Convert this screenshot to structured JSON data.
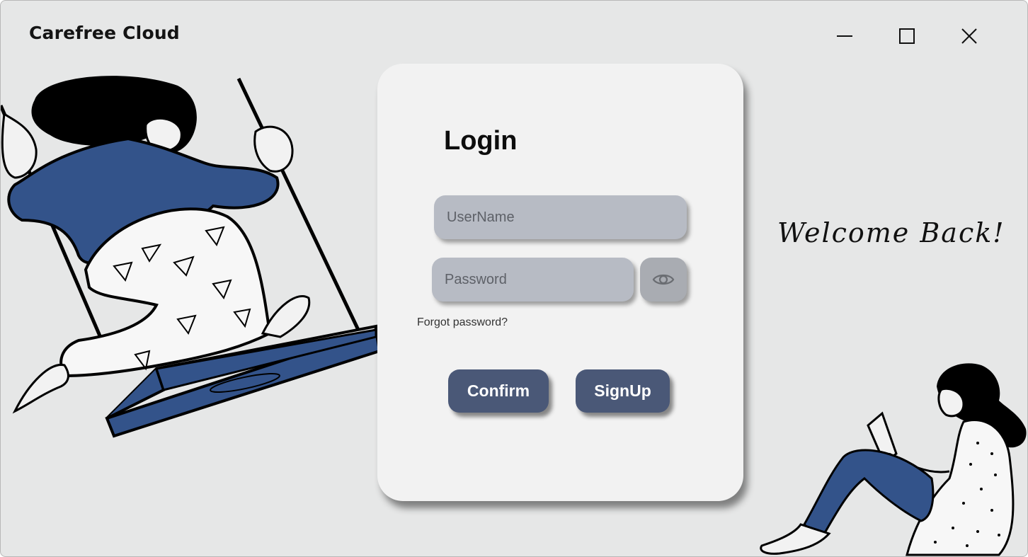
{
  "window": {
    "title": "Carefree Cloud",
    "controls": {
      "minimize_icon": "minimize-icon",
      "maximize_icon": "maximize-icon",
      "close_icon": "close-icon"
    }
  },
  "welcome": {
    "text": "Welcome Back!"
  },
  "login": {
    "title": "Login",
    "username_placeholder": "UserName",
    "username_value": "",
    "password_placeholder": "Password",
    "password_value": "",
    "show_password_icon": "eye-icon",
    "forgot_label": "Forgot password?",
    "confirm_label": "Confirm",
    "signup_label": "SignUp"
  },
  "colors": {
    "background": "#e6e7e7",
    "card": "#f2f2f2",
    "field": "#b7bbc4",
    "button": "#4a5877",
    "illustration_blue": "#33538a"
  }
}
